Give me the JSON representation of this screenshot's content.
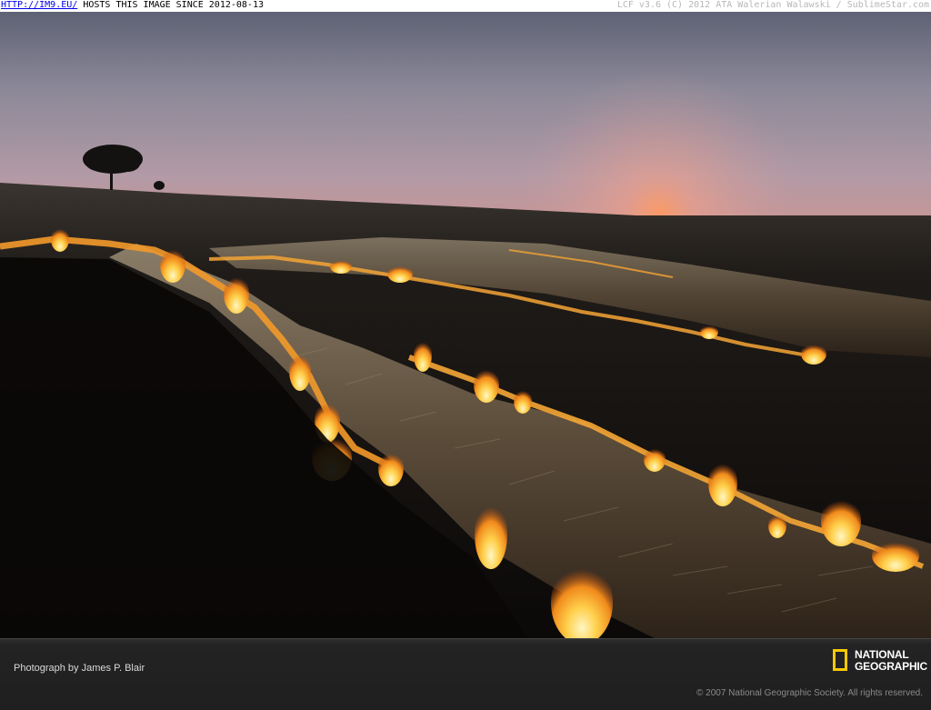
{
  "banner": {
    "link_text": "HTTP://IM9.EU/",
    "hosts_text": " HOSTS THIS IMAGE SINCE 2012-08-13",
    "right_text": "LCF v3.6 (C) 2012 ATA Walerian Walawski / SublimeStar.com"
  },
  "photo": {
    "description_name": "burning-field-at-sunset"
  },
  "footer": {
    "credit": "Photograph by James P. Blair",
    "copyright": "© 2007 National Geographic Society. All rights reserved.",
    "logo_line1": "NATIONAL",
    "logo_line2": "GEOGRAPHIC",
    "logo_color": "#f7c900"
  }
}
